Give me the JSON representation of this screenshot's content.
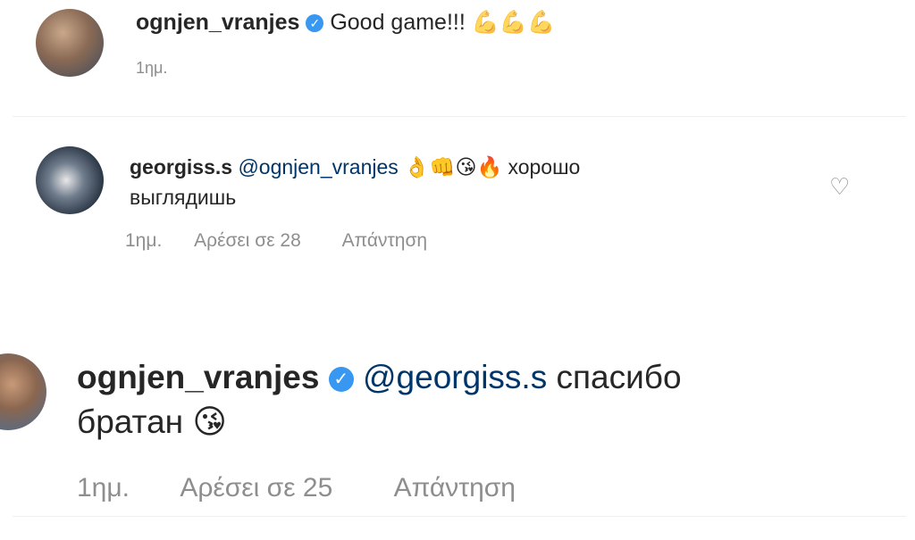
{
  "comments": [
    {
      "username": "ognjen_vranjes",
      "text": "Good game!!!",
      "emojis": "💪💪💪",
      "time": "1ημ."
    },
    {
      "username": "georgiss.s",
      "mention": "@ognjen_vranjes",
      "emojis": "👌👊😘🔥",
      "text_line1": "хорошо",
      "text_line2": "выглядишь",
      "time": "1ημ.",
      "likes": "Αρέσει σε 28",
      "reply": "Απάντηση"
    },
    {
      "username": "ognjen_vranjes",
      "mention": "@georgiss.s",
      "text_line1": "спасибо",
      "text_line2": "братан",
      "emojis": "😘",
      "time": "1ημ.",
      "likes": "Αρέσει σε 25",
      "reply": "Απάντηση"
    }
  ],
  "icons": {
    "verified": "verified-badge-icon",
    "heart": "heart-icon"
  },
  "colors": {
    "verified": "#3897f0",
    "meta": "#8e8e8e",
    "mention": "#003569"
  }
}
